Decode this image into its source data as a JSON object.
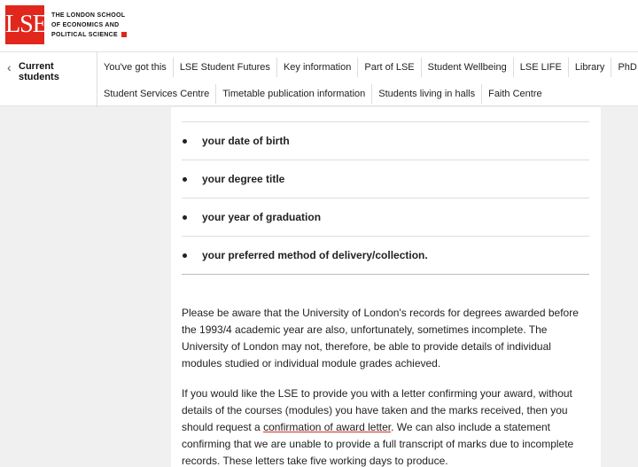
{
  "header": {
    "logo": "LSE",
    "school_line1": "THE LONDON SCHOOL",
    "school_line2": "OF ECONOMICS AND",
    "school_line3": "POLITICAL SCIENCE"
  },
  "nav": {
    "back_label": "Current students",
    "row1": [
      "You've got this",
      "LSE Student Futures",
      "Key information",
      "Part of LSE",
      "Student Wellbeing",
      "LSE LIFE",
      "Library",
      "PhD Acad"
    ],
    "row2": [
      "Student Services Centre",
      "Timetable publication information",
      "Students living in halls",
      "Faith Centre"
    ]
  },
  "list": {
    "items": [
      "your date of birth",
      "your degree title",
      "your year of graduation",
      "your preferred method of delivery/collection."
    ]
  },
  "body": {
    "para1": "Please be aware that the University of London's records for degrees awarded before the 1993/4 academic year are also, unfortunately, sometimes incomplete. The University of London may not, therefore, be able to provide details of individual modules studied or individual module grades achieved.",
    "para2_before": "If you would like the LSE to provide you with a letter confirming your award, without details of the courses (modules) you have taken and the marks received, then you should request a ",
    "para2_link": "confirmation of award letter",
    "para2_after": ". We can also include a statement confirming that we are unable to provide a full transcript of marks due to incomplete records. These letters take five working days to produce."
  },
  "colors": {
    "brand_red": "#e1261c"
  }
}
